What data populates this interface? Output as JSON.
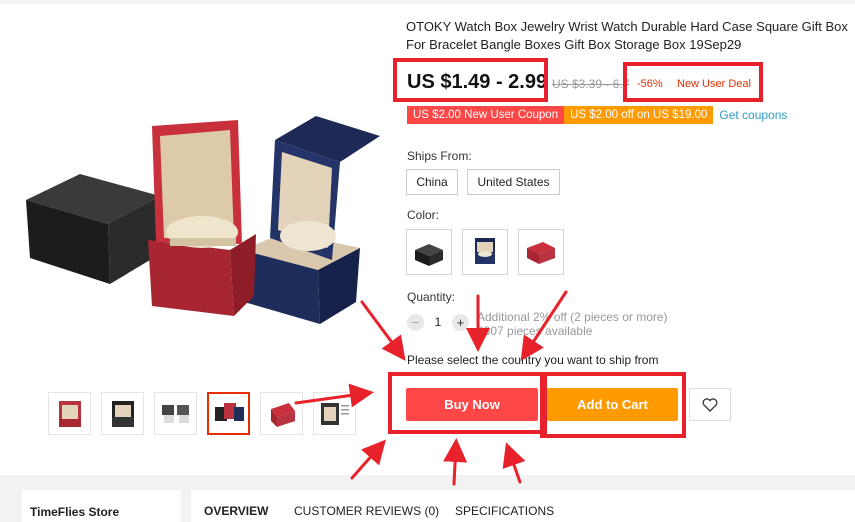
{
  "product": {
    "title": "OTOKY Watch Box Jewelry Wrist Watch Durable Hard Case Square Gift Box For Bracelet Bangle Boxes Gift Box Storage Box 19Sep29",
    "price": "US $1.49 - 2.99",
    "original_price": "US $3.39 - 6.7",
    "discount_percent": "-56%",
    "deal_label": "New User Deal"
  },
  "coupons": {
    "items": [
      {
        "label": "US $2.00 New User Coupon",
        "color": "#ff4747"
      },
      {
        "label": "US $2.00 off on US $19.00",
        "color": "#ff9a00"
      }
    ],
    "link": "Get coupons"
  },
  "ships_from": {
    "label": "Ships From:",
    "options": [
      "China",
      "United States"
    ]
  },
  "color": {
    "label": "Color:",
    "swatches": [
      "black-watch-box",
      "navy-watch-box",
      "red-watch-box"
    ]
  },
  "quantity": {
    "label": "Quantity:",
    "minus": "−",
    "value": "1",
    "plus": "+",
    "note_line1": "Additional 2% off (2 pieces or more)",
    "note_line2": "6307 pieces available"
  },
  "ship_notice": "Please select the country you want to ship from",
  "actions": {
    "buy_now": "Buy Now",
    "add_to_cart": "Add to Cart",
    "wishlist_icon": "heart-icon"
  },
  "store": {
    "name": "TimeFlies Store"
  },
  "tabs": [
    "OVERVIEW",
    "CUSTOMER REVIEWS (0)",
    "SPECIFICATIONS"
  ],
  "colors": {
    "accent_red": "#ff4747",
    "accent_orange": "#ff9a00",
    "annotation_red": "#e8222a",
    "link_blue": "#2e9cc3"
  }
}
